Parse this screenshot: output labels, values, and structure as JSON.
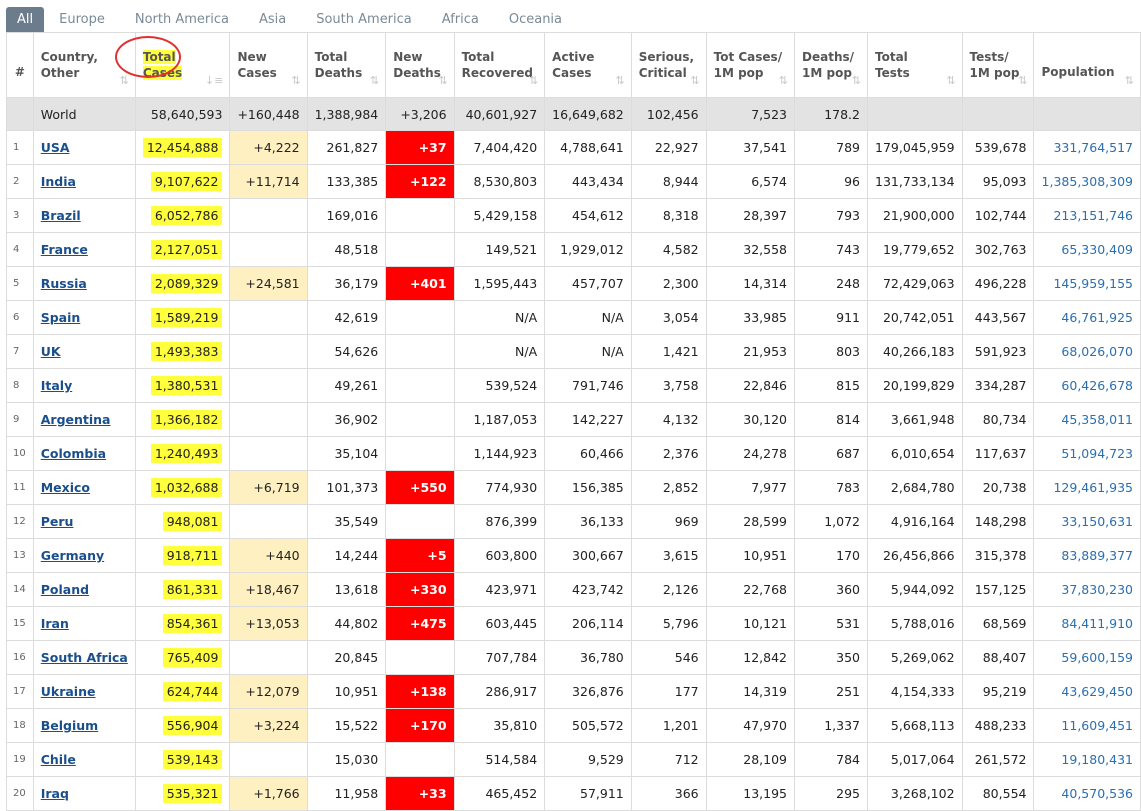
{
  "tabs": [
    "All",
    "Europe",
    "North America",
    "Asia",
    "South America",
    "Africa",
    "Oceania"
  ],
  "columns": [
    {
      "l1": "#",
      "l2": ""
    },
    {
      "l1": "Country,",
      "l2": "Other"
    },
    {
      "l1": "Total",
      "l2": "Cases"
    },
    {
      "l1": "New",
      "l2": "Cases"
    },
    {
      "l1": "Total",
      "l2": "Deaths"
    },
    {
      "l1": "New",
      "l2": "Deaths"
    },
    {
      "l1": "Total",
      "l2": "Recovered"
    },
    {
      "l1": "Active",
      "l2": "Cases"
    },
    {
      "l1": "Serious,",
      "l2": "Critical"
    },
    {
      "l1": "Tot Cases/",
      "l2": "1M pop"
    },
    {
      "l1": "Deaths/",
      "l2": "1M pop"
    },
    {
      "l1": "Total",
      "l2": "Tests"
    },
    {
      "l1": "Tests/",
      "l2": "1M pop"
    },
    {
      "l1": "Population",
      "l2": ""
    }
  ],
  "world": [
    "",
    "World",
    "58,640,593",
    "+160,448",
    "1,388,984",
    "+3,206",
    "40,601,927",
    "16,649,682",
    "102,456",
    "7,523",
    "178.2",
    "",
    "",
    ""
  ],
  "rows": [
    [
      "1",
      "USA",
      "12,454,888",
      "+4,222",
      "261,827",
      "+37",
      "7,404,420",
      "4,788,641",
      "22,927",
      "37,541",
      "789",
      "179,045,959",
      "539,678",
      "331,764,517"
    ],
    [
      "2",
      "India",
      "9,107,622",
      "+11,714",
      "133,385",
      "+122",
      "8,530,803",
      "443,434",
      "8,944",
      "6,574",
      "96",
      "131,733,134",
      "95,093",
      "1,385,308,309"
    ],
    [
      "3",
      "Brazil",
      "6,052,786",
      "",
      "169,016",
      "",
      "5,429,158",
      "454,612",
      "8,318",
      "28,397",
      "793",
      "21,900,000",
      "102,744",
      "213,151,746"
    ],
    [
      "4",
      "France",
      "2,127,051",
      "",
      "48,518",
      "",
      "149,521",
      "1,929,012",
      "4,582",
      "32,558",
      "743",
      "19,779,652",
      "302,763",
      "65,330,409"
    ],
    [
      "5",
      "Russia",
      "2,089,329",
      "+24,581",
      "36,179",
      "+401",
      "1,595,443",
      "457,707",
      "2,300",
      "14,314",
      "248",
      "72,429,063",
      "496,228",
      "145,959,155"
    ],
    [
      "6",
      "Spain",
      "1,589,219",
      "",
      "42,619",
      "",
      "N/A",
      "N/A",
      "3,054",
      "33,985",
      "911",
      "20,742,051",
      "443,567",
      "46,761,925"
    ],
    [
      "7",
      "UK",
      "1,493,383",
      "",
      "54,626",
      "",
      "N/A",
      "N/A",
      "1,421",
      "21,953",
      "803",
      "40,266,183",
      "591,923",
      "68,026,070"
    ],
    [
      "8",
      "Italy",
      "1,380,531",
      "",
      "49,261",
      "",
      "539,524",
      "791,746",
      "3,758",
      "22,846",
      "815",
      "20,199,829",
      "334,287",
      "60,426,678"
    ],
    [
      "9",
      "Argentina",
      "1,366,182",
      "",
      "36,902",
      "",
      "1,187,053",
      "142,227",
      "4,132",
      "30,120",
      "814",
      "3,661,948",
      "80,734",
      "45,358,011"
    ],
    [
      "10",
      "Colombia",
      "1,240,493",
      "",
      "35,104",
      "",
      "1,144,923",
      "60,466",
      "2,376",
      "24,278",
      "687",
      "6,010,654",
      "117,637",
      "51,094,723"
    ],
    [
      "11",
      "Mexico",
      "1,032,688",
      "+6,719",
      "101,373",
      "+550",
      "774,930",
      "156,385",
      "2,852",
      "7,977",
      "783",
      "2,684,780",
      "20,738",
      "129,461,935"
    ],
    [
      "12",
      "Peru",
      "948,081",
      "",
      "35,549",
      "",
      "876,399",
      "36,133",
      "969",
      "28,599",
      "1,072",
      "4,916,164",
      "148,298",
      "33,150,631"
    ],
    [
      "13",
      "Germany",
      "918,711",
      "+440",
      "14,244",
      "+5",
      "603,800",
      "300,667",
      "3,615",
      "10,951",
      "170",
      "26,456,866",
      "315,378",
      "83,889,377"
    ],
    [
      "14",
      "Poland",
      "861,331",
      "+18,467",
      "13,618",
      "+330",
      "423,971",
      "423,742",
      "2,126",
      "22,768",
      "360",
      "5,944,092",
      "157,125",
      "37,830,230"
    ],
    [
      "15",
      "Iran",
      "854,361",
      "+13,053",
      "44,802",
      "+475",
      "603,445",
      "206,114",
      "5,796",
      "10,121",
      "531",
      "5,788,016",
      "68,569",
      "84,411,910"
    ],
    [
      "16",
      "South Africa",
      "765,409",
      "",
      "20,845",
      "",
      "707,784",
      "36,780",
      "546",
      "12,842",
      "350",
      "5,269,062",
      "88,407",
      "59,600,159"
    ],
    [
      "17",
      "Ukraine",
      "624,744",
      "+12,079",
      "10,951",
      "+138",
      "286,917",
      "326,876",
      "177",
      "14,319",
      "251",
      "4,154,333",
      "95,219",
      "43,629,450"
    ],
    [
      "18",
      "Belgium",
      "556,904",
      "+3,224",
      "15,522",
      "+170",
      "35,810",
      "505,572",
      "1,201",
      "47,970",
      "1,337",
      "5,668,113",
      "488,233",
      "11,609,451"
    ],
    [
      "19",
      "Chile",
      "539,143",
      "",
      "15,030",
      "",
      "514,584",
      "9,529",
      "712",
      "28,109",
      "784",
      "5,017,064",
      "261,572",
      "19,180,431"
    ],
    [
      "20",
      "Iraq",
      "535,321",
      "+1,766",
      "11,958",
      "+33",
      "465,452",
      "57,911",
      "366",
      "13,195",
      "295",
      "3,268,102",
      "80,554",
      "40,570,536"
    ]
  ],
  "colors": {
    "new_cases_bg": "#fff0c2",
    "new_deaths_bg": "#ff0000",
    "highlight": "#ffff3d",
    "link": "#1a4f8c",
    "population": "#2a6fb0"
  },
  "icons": {
    "sort": "sort-arrows-icon",
    "sort_active": "sort-desc-icon"
  }
}
